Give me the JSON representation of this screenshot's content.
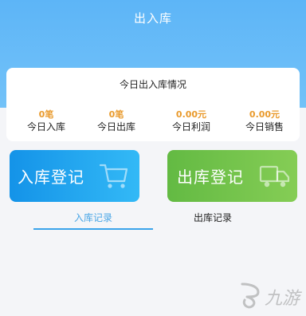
{
  "header": {
    "title": "出入库"
  },
  "summary": {
    "title": "今日出入库情况",
    "stats": [
      {
        "value": "0笔",
        "label": "今日入库"
      },
      {
        "value": "0笔",
        "label": "今日出库"
      },
      {
        "value": "0.00元",
        "label": "今日利润"
      },
      {
        "value": "0.00元",
        "label": "今日销售"
      }
    ],
    "value_color": "#e99a2c"
  },
  "actions": {
    "stock_in": {
      "label": "入库登记",
      "icon": "shopping-cart-icon",
      "color": "#1a9bec"
    },
    "stock_out": {
      "label": "出库登记",
      "icon": "delivery-truck-icon",
      "color": "#6cbf48"
    }
  },
  "tabs": [
    {
      "label": "入库记录",
      "active": true
    },
    {
      "label": "出库记录",
      "active": false
    }
  ],
  "watermark": {
    "text": "九游"
  }
}
